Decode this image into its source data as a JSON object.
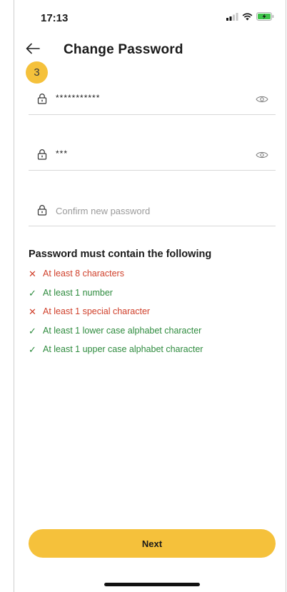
{
  "status_bar": {
    "time": "17:13",
    "icons": [
      "signal-icon",
      "wifi-icon",
      "battery-charging-icon"
    ]
  },
  "header": {
    "title": "Change Password",
    "back_icon": "arrow-left-icon"
  },
  "step_badge": "3",
  "fields": {
    "current_password": {
      "value": "***********",
      "icon": "lock-icon",
      "toggle_icon": "eye-icon"
    },
    "new_password": {
      "value": "***",
      "icon": "lock-icon",
      "toggle_icon": "eye-icon"
    },
    "confirm_password": {
      "placeholder": "Confirm new password",
      "icon": "lock-icon"
    }
  },
  "requirements": {
    "title": "Password must contain the following",
    "items": [
      {
        "mark": "✕",
        "text": "At least 8 characters",
        "met": false
      },
      {
        "mark": "✓",
        "text": "At least 1 number",
        "met": true
      },
      {
        "mark": "✕",
        "text": "At least 1 special character",
        "met": false
      },
      {
        "mark": "✓",
        "text": "At least 1 lower case alphabet character",
        "met": true
      },
      {
        "mark": "✓",
        "text": "At least 1 upper case alphabet character",
        "met": true
      }
    ]
  },
  "next_button": {
    "label": "Next"
  },
  "colors": {
    "accent": "#f5c13b",
    "error": "#d0402b",
    "success": "#2e8b3e"
  }
}
